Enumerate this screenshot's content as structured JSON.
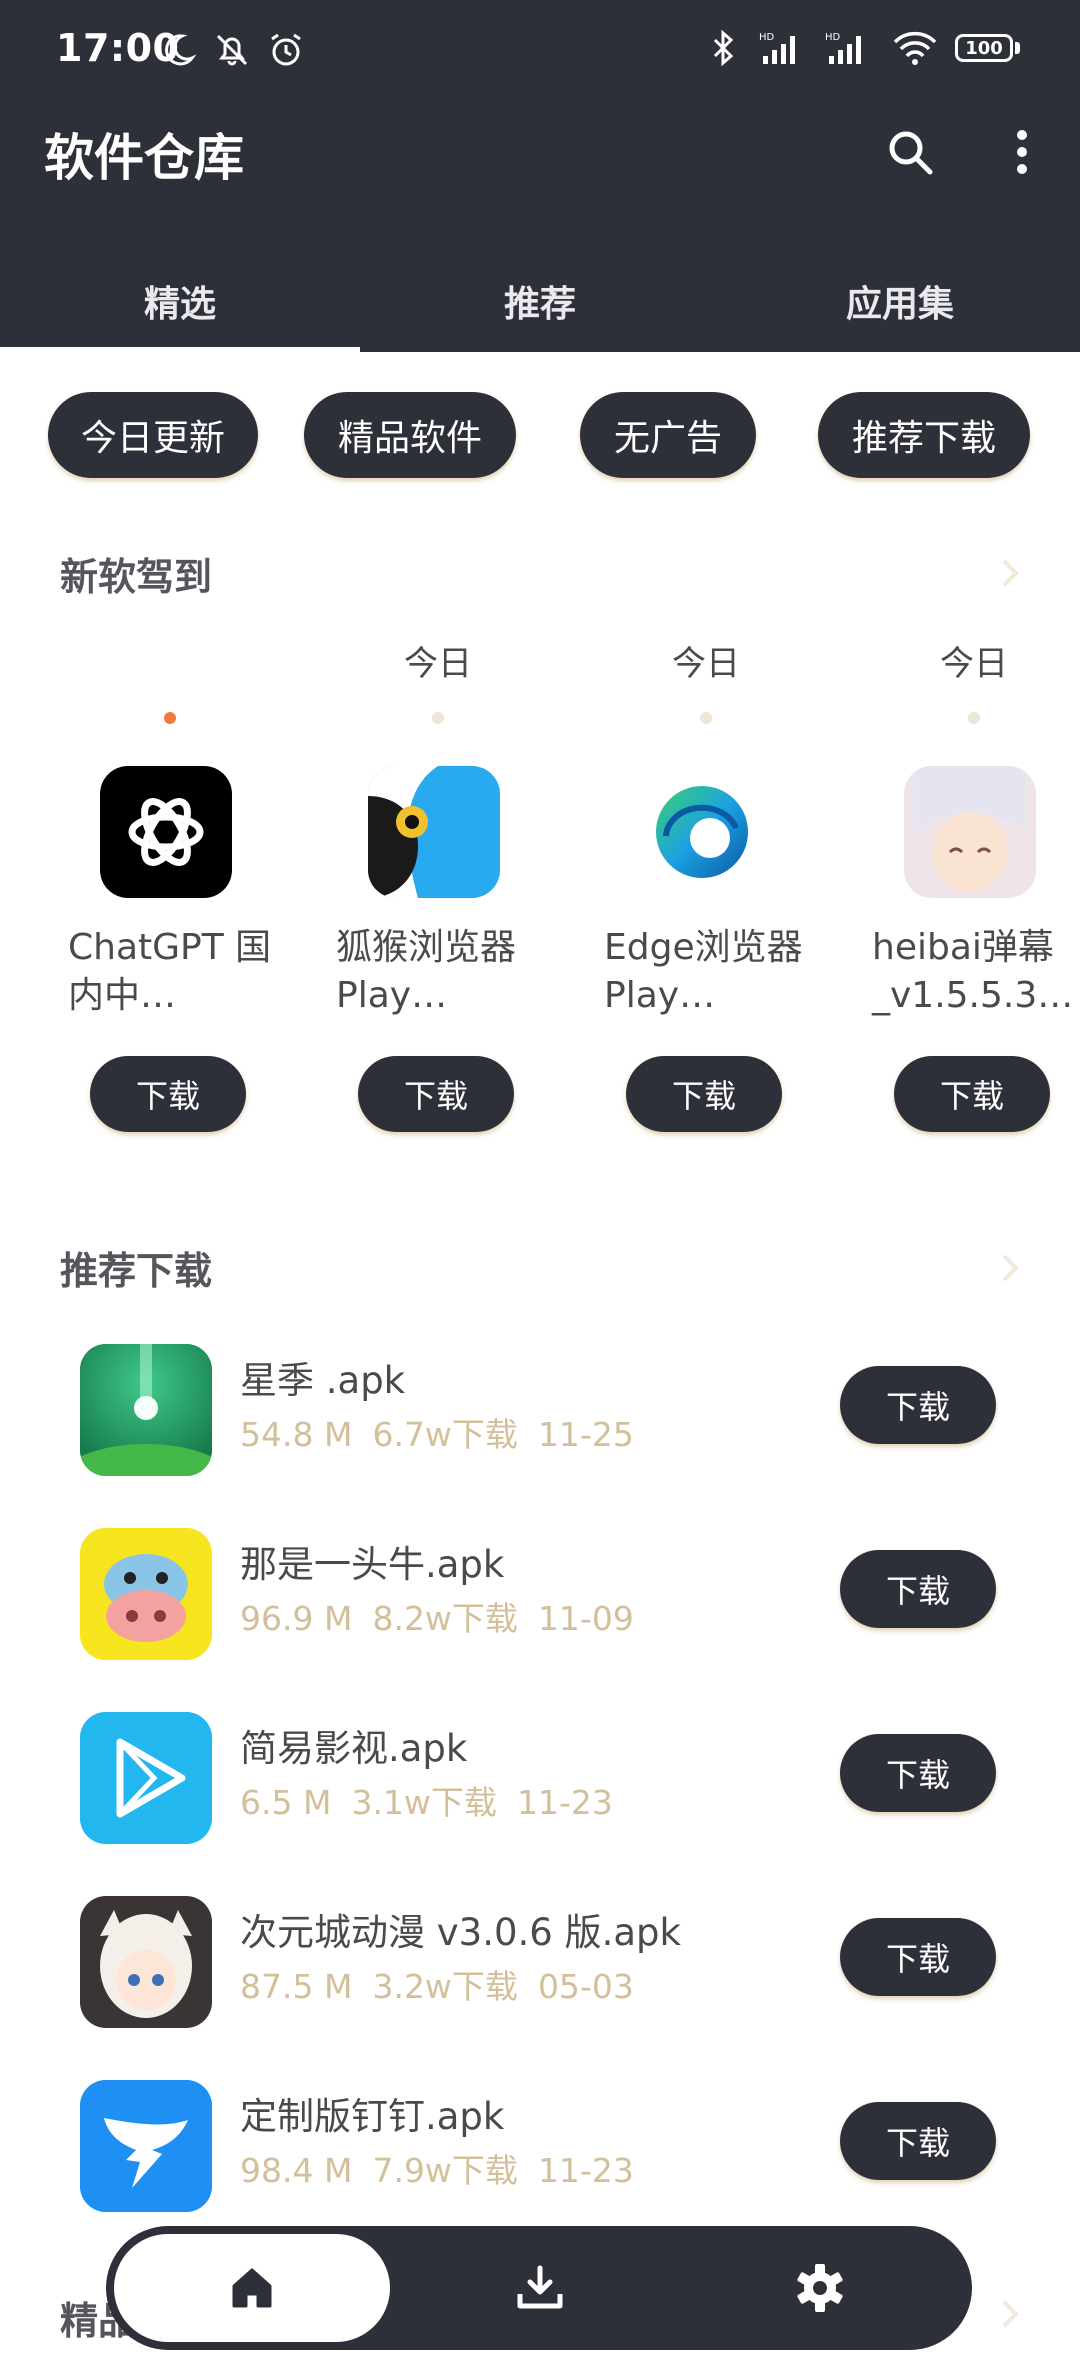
{
  "status_bar": {
    "time": "17:00",
    "battery": "100",
    "icons_left": [
      "moon-icon",
      "bell-off-icon",
      "alarm-icon"
    ],
    "icons_right": [
      "bluetooth-icon",
      "signal-hd-icon",
      "signal-hd-icon",
      "wifi-icon",
      "battery-icon"
    ]
  },
  "header": {
    "title": "软件仓库",
    "search_icon": "search-icon",
    "more_icon": "more-vertical-icon"
  },
  "tabs": [
    {
      "label": "精选",
      "active": true
    },
    {
      "label": "推荐",
      "active": false
    },
    {
      "label": "应用集",
      "active": false
    }
  ],
  "chips": [
    "今日更新",
    "精品软件",
    "无广告",
    "推荐下载"
  ],
  "new_software": {
    "title": "新软驾到",
    "items": [
      {
        "date": "",
        "name": "ChatGPT 国内中…",
        "button": "下载",
        "icon": "chatgpt-icon"
      },
      {
        "date": "今日",
        "name": "狐猴浏览器 Play…",
        "button": "下载",
        "icon": "lemur-browser-icon"
      },
      {
        "date": "今日",
        "name": "Edge浏览器 Play…",
        "button": "下载",
        "icon": "edge-browser-icon"
      },
      {
        "date": "今日",
        "name": "heibai弹幕_v1.5.5.3…",
        "button": "下载",
        "icon": "anime-girl-icon"
      }
    ]
  },
  "recommended": {
    "title": "推荐下载",
    "items": [
      {
        "name": "星季 .apk",
        "size": "54.8 M",
        "downloads": "6.7w下载",
        "date": "11-25",
        "button": "下载",
        "icon": "xingji-icon"
      },
      {
        "name": "那是一头牛.apk",
        "size": "96.9 M",
        "downloads": "8.2w下载",
        "date": "11-09",
        "button": "下载",
        "icon": "cow-icon"
      },
      {
        "name": "简易影视.apk",
        "size": "6.5 M",
        "downloads": "3.1w下载",
        "date": "11-23",
        "button": "下载",
        "icon": "play-store-icon"
      },
      {
        "name": "次元城动漫 v3.0.6 版.apk",
        "size": "87.5 M",
        "downloads": "3.2w下载",
        "date": "05-03",
        "button": "下载",
        "icon": "anime-icon"
      },
      {
        "name": "定制版钉钉.apk",
        "size": "98.4 M",
        "downloads": "7.9w下载",
        "date": "11-23",
        "button": "下载",
        "icon": "dingtalk-icon"
      }
    ]
  },
  "next_section": {
    "title": "精品"
  },
  "bottom_nav": [
    {
      "icon": "home-icon",
      "active": true
    },
    {
      "icon": "download-icon",
      "active": false
    },
    {
      "icon": "settings-icon",
      "active": false
    }
  ],
  "colors": {
    "dark": "#2e3039",
    "accent_dot": "#f07a3a",
    "meta": "#d3c09a"
  }
}
